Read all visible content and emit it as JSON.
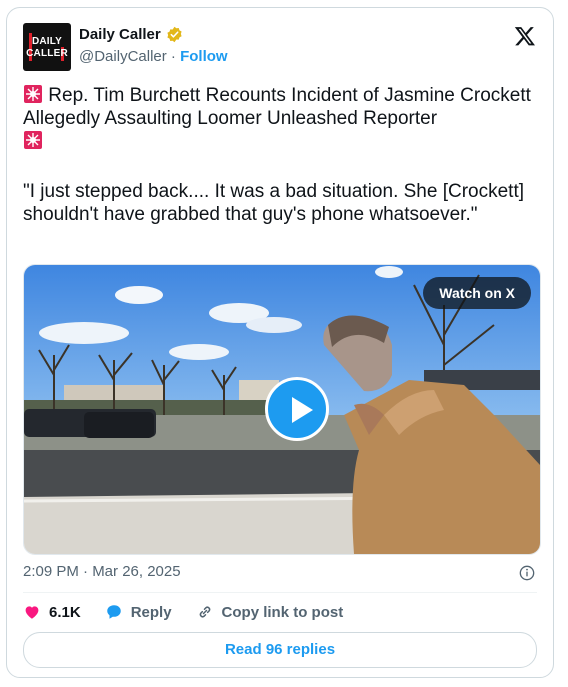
{
  "author": {
    "name": "Daily Caller",
    "handle": "@DailyCaller",
    "separator": "·",
    "follow_label": "Follow",
    "avatar_line1": "DAILY",
    "avatar_line2": "CALLER",
    "verified_icon": "gold-verified-badge-icon"
  },
  "platform_icon": "x-logo-icon",
  "tweet": {
    "headline": "Rep. Tim Burchett Recounts Incident of Jasmine Crockett Allegedly Assaulting Loomer Unleashed Reporter",
    "quote": "\"I just stepped back.... It was a bad situation. She [Crockett] shouldn't have grabbed that guy's phone whatsoever.\"",
    "emoji_icon": "siren-icon"
  },
  "video": {
    "watch_label": "Watch on X",
    "play_icon": "play-icon"
  },
  "timestamp": "2:09 PM · Mar 26, 2025",
  "actions": {
    "like_count": "6.1K",
    "reply_label": "Reply",
    "copy_label": "Copy link to post"
  },
  "read_replies_label": "Read 96 replies",
  "colors": {
    "accent": "#1d9bf0",
    "like": "#f91880",
    "siren": "#e0245e"
  }
}
